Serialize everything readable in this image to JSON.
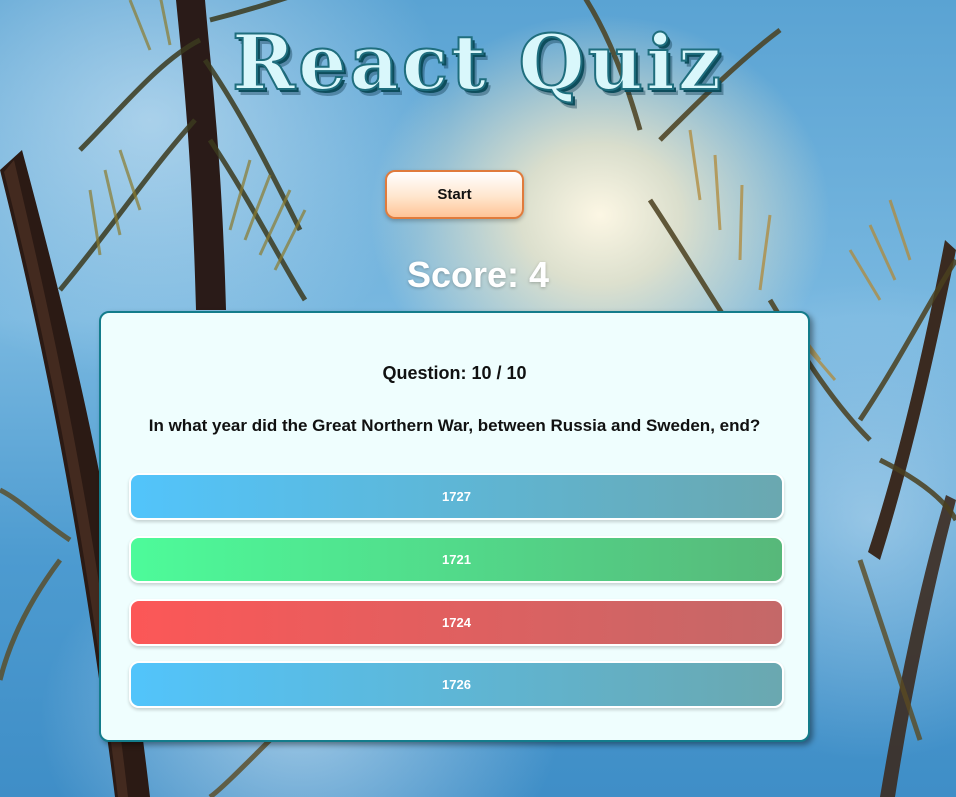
{
  "title": "React Quiz",
  "start_button": "Start",
  "score": "Score: 4",
  "question": {
    "number": "Question: 10 / 10",
    "text": "In what year did the Great Northern War, between Russia and Sweden, end?"
  },
  "answers": [
    {
      "label": "1727",
      "state": "neutral",
      "color_start": "#52c4fb",
      "color_end": "#6aa8b0"
    },
    {
      "label": "1721",
      "state": "correct",
      "color_start": "#4dfb9a",
      "color_end": "#57b87a"
    },
    {
      "label": "1724",
      "state": "wrong",
      "color_start": "#fc5757",
      "color_end": "#c46868"
    },
    {
      "label": "1726",
      "state": "neutral",
      "color_start": "#52c4fb",
      "color_end": "#6aa8b0"
    }
  ],
  "colors": {
    "title_fill": "#d9f7fb",
    "title_outline": "#1f6e7e",
    "card_background": "#effefe",
    "card_border": "#137c8b",
    "start_border": "#e07b3c"
  }
}
